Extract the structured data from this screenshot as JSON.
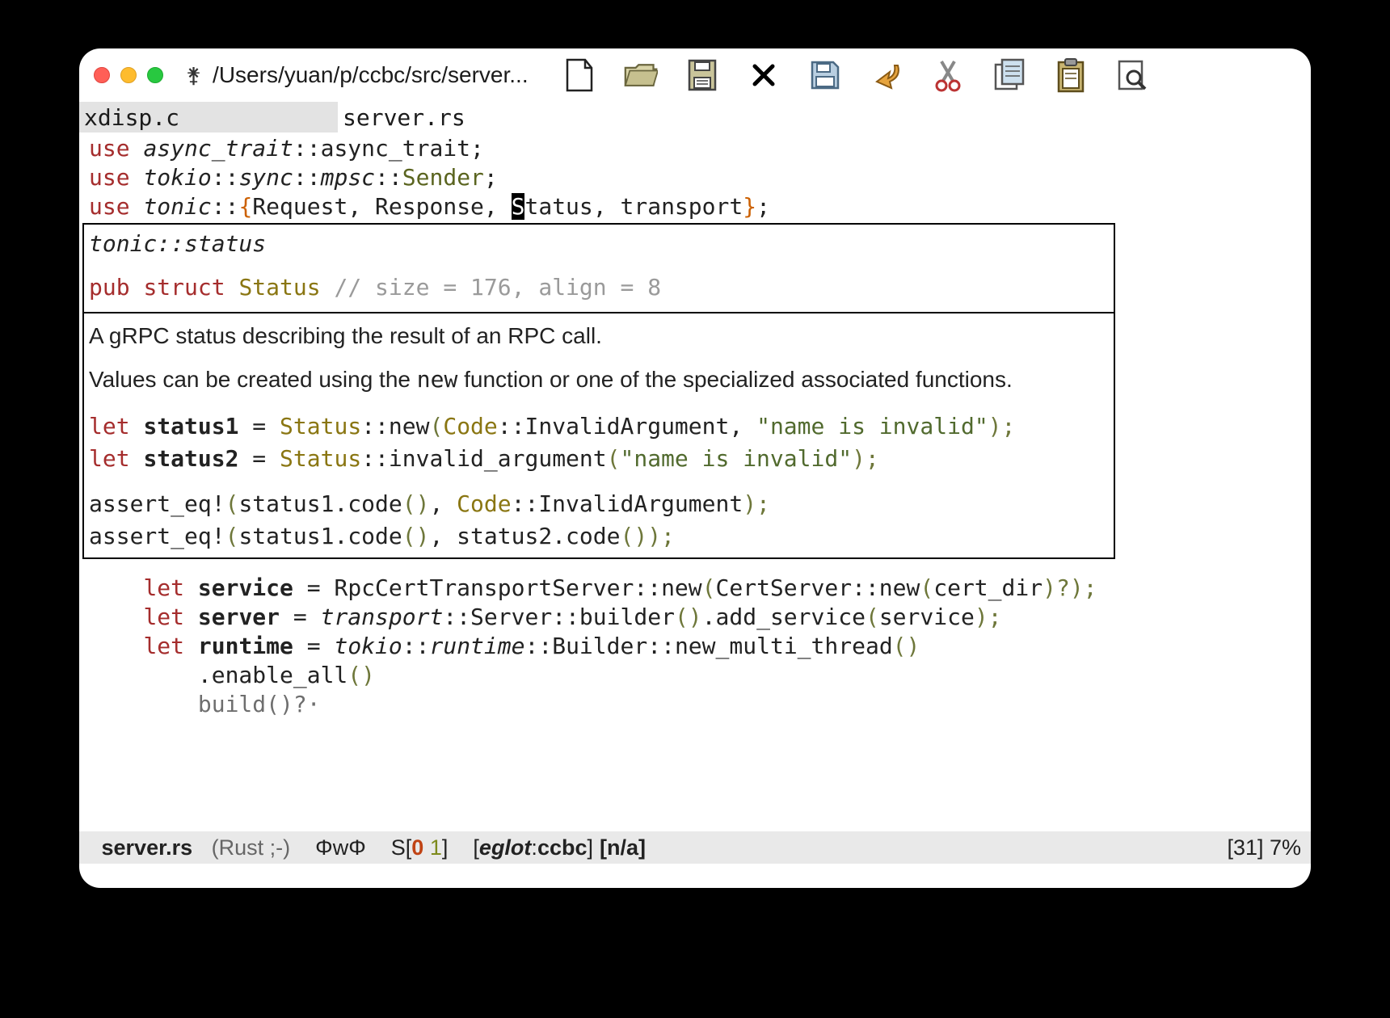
{
  "window": {
    "title_path": "/Users/yuan/p/ccbc/src/server...",
    "vcs_glyph": "⚵"
  },
  "toolbar": {
    "items": [
      {
        "name": "new-file-icon"
      },
      {
        "name": "open-folder-icon"
      },
      {
        "name": "disk-icon"
      },
      {
        "name": "close-x-icon"
      },
      {
        "name": "save-icon"
      },
      {
        "name": "undo-icon"
      },
      {
        "name": "cut-icon"
      },
      {
        "name": "copy-icon"
      },
      {
        "name": "paste-icon"
      },
      {
        "name": "search-icon"
      }
    ]
  },
  "tabs": [
    {
      "label": "xdisp.c",
      "active": false
    },
    {
      "label": "server.rs",
      "active": true
    }
  ],
  "code_top": {
    "l1": {
      "kw": "use",
      "path": "async_trait",
      "ident": "async_trait"
    },
    "l2": {
      "kw": "use",
      "p1": "tokio",
      "p2": "sync",
      "p3": "mpsc",
      "ident": "Sender"
    },
    "l3": {
      "kw": "use",
      "p1": "tonic",
      "items": [
        "Request",
        "Response",
        "Status",
        "transport"
      ],
      "cursor_on": "S"
    }
  },
  "hover": {
    "crumb": "tonic::status",
    "sig_kw1": "pub",
    "sig_kw2": "struct",
    "sig_name": "Status",
    "sig_comment": "// size = 176, align = 8",
    "desc1": "A gRPC status describing the result of an RPC call.",
    "desc2a": "Values can be created using the ",
    "desc2_mono": "new",
    "desc2b": " function or one of the specialized associated functions.",
    "ex": {
      "l1": {
        "let": "let",
        "var": "status1",
        "eq": " = ",
        "ty": "Status",
        "m": "::",
        "fn": "new",
        "open": "(",
        "c1": "Code",
        "dbl": "::",
        "c2": "InvalidArgument",
        "comma": ", ",
        "str": "\"name is invalid\"",
        "close": ");"
      },
      "l2": {
        "let": "let",
        "var": "status2",
        "eq": " = ",
        "ty": "Status",
        "m": "::",
        "fn": "invalid_argument",
        "open": "(",
        "str": "\"name is invalid\"",
        "close": ");"
      },
      "l3": {
        "mac": "assert_eq!",
        "open": "(",
        "a": "status1.code",
        "p": "()",
        "comma": ", ",
        "c1": "Code",
        "m": "::",
        "c2": "InvalidArgument",
        "close": ");"
      },
      "l4": {
        "mac": "assert_eq!",
        "open": "(",
        "a": "status1.code",
        "p": "()",
        "comma": ", ",
        "b": "status2.code",
        "p2": "()",
        "close": ");"
      }
    }
  },
  "code_bottom": {
    "l1": {
      "let": "let",
      "var": "service",
      "eq": " = ",
      "ty": "RpcCertTransportServer",
      "m": "::",
      "fn": "new",
      "open": "(",
      "ty2": "CertServer",
      "m2": "::",
      "fn2": "new",
      "open2": "(",
      "arg": "cert_dir",
      "close2": ")?",
      "close": ");"
    },
    "l2": {
      "let": "let",
      "var": "server",
      "eq": " = ",
      "ns": "transport",
      "m": "::",
      "ty": "Server",
      "m2": "::",
      "fn": "builder",
      "p": "()",
      "dot": ".",
      "fn2": "add_service",
      "open": "(",
      "arg": "service",
      "close": ");"
    },
    "l3": {
      "let": "let",
      "var": "runtime",
      "eq": " = ",
      "ns": "tokio",
      "m": "::",
      "ns2": "runtime",
      "m2": "::",
      "ty": "Builder",
      "m3": "::",
      "fn": "new_multi_thread",
      "p": "()"
    },
    "l4": {
      "dot": ".",
      "fn": "enable_all",
      "p": "()"
    },
    "l5": {
      "txt": "build()?·"
    }
  },
  "modeline": {
    "filename": "server.rs",
    "mode": "(Rust ;-)",
    "enc": "ΦwΦ",
    "diag_prefix": "S[",
    "diag_err": "0",
    "diag_sep": " ",
    "diag_warn": "1",
    "diag_suffix": "]",
    "eglot_open": "[",
    "eglot_label": "eglot",
    "eglot_sep": ":",
    "eglot_proj": "ccbc",
    "eglot_close": "]",
    "na": "[n/a]",
    "pos": "[31] 7%"
  }
}
